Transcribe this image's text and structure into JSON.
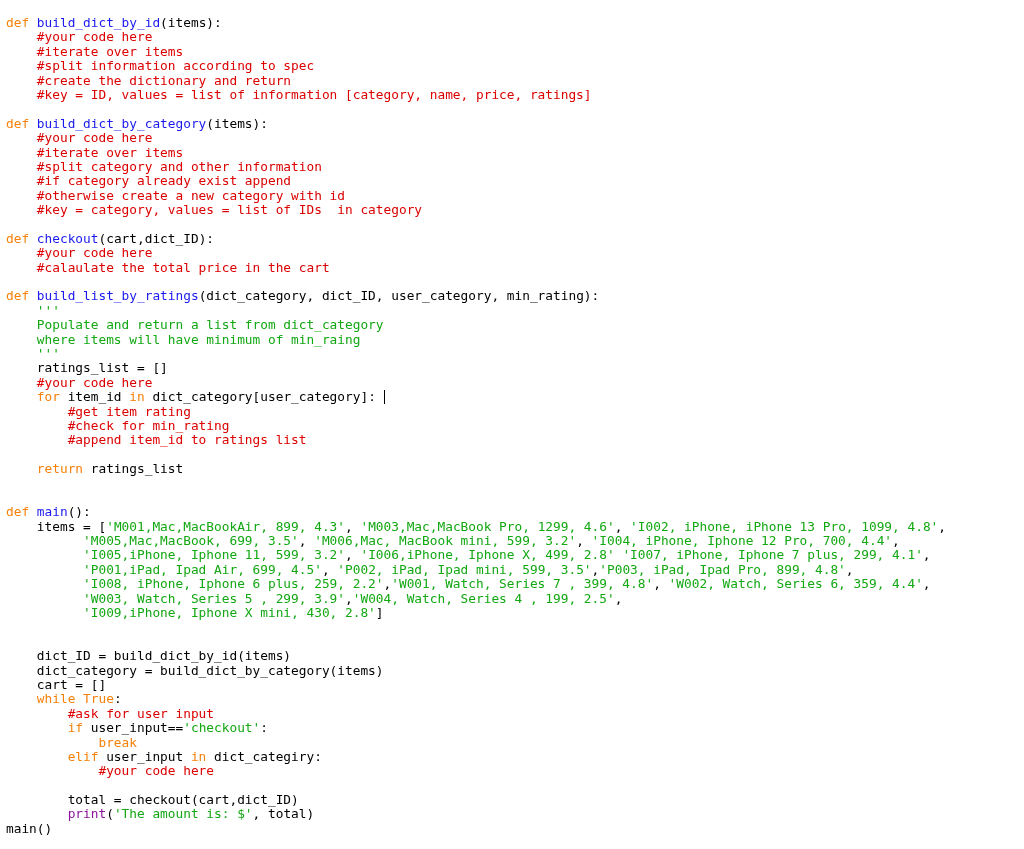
{
  "editor": {
    "lines": [
      {
        "kind": "code",
        "tokens": [
          {
            "kind": "keyword",
            "text": "def "
          },
          {
            "kind": "function",
            "text": "build_dict_by_id"
          },
          {
            "kind": "plain",
            "text": "(items):"
          }
        ]
      },
      {
        "kind": "code",
        "tokens": [
          {
            "kind": "comment",
            "text": "    #your code here"
          }
        ]
      },
      {
        "kind": "code",
        "tokens": [
          {
            "kind": "comment",
            "text": "    #iterate over items"
          }
        ]
      },
      {
        "kind": "code",
        "tokens": [
          {
            "kind": "comment",
            "text": "    #split information according to spec"
          }
        ]
      },
      {
        "kind": "code",
        "tokens": [
          {
            "kind": "comment",
            "text": "    #create the dictionary and return"
          }
        ]
      },
      {
        "kind": "code",
        "tokens": [
          {
            "kind": "comment",
            "text": "    #key = ID, values = list of information [category, name, price, ratings]"
          }
        ]
      },
      {
        "kind": "blank"
      },
      {
        "kind": "code",
        "tokens": [
          {
            "kind": "keyword",
            "text": "def "
          },
          {
            "kind": "function",
            "text": "build_dict_by_category"
          },
          {
            "kind": "plain",
            "text": "(items):"
          }
        ]
      },
      {
        "kind": "code",
        "tokens": [
          {
            "kind": "comment",
            "text": "    #your code here"
          }
        ]
      },
      {
        "kind": "code",
        "tokens": [
          {
            "kind": "comment",
            "text": "    #iterate over items"
          }
        ]
      },
      {
        "kind": "code",
        "tokens": [
          {
            "kind": "comment",
            "text": "    #split category and other information"
          }
        ]
      },
      {
        "kind": "code",
        "tokens": [
          {
            "kind": "comment",
            "text": "    #if category already exist append"
          }
        ]
      },
      {
        "kind": "code",
        "tokens": [
          {
            "kind": "comment",
            "text": "    #otherwise create a new category with id"
          }
        ]
      },
      {
        "kind": "code",
        "tokens": [
          {
            "kind": "comment",
            "text": "    #key = category, values = list of IDs  in category"
          }
        ]
      },
      {
        "kind": "blank"
      },
      {
        "kind": "code",
        "tokens": [
          {
            "kind": "keyword",
            "text": "def "
          },
          {
            "kind": "function",
            "text": "checkout"
          },
          {
            "kind": "plain",
            "text": "(cart,dict_ID):"
          }
        ]
      },
      {
        "kind": "code",
        "tokens": [
          {
            "kind": "comment",
            "text": "    #your code here"
          }
        ]
      },
      {
        "kind": "code",
        "tokens": [
          {
            "kind": "comment",
            "text": "    #calaulate the total price in the cart"
          }
        ]
      },
      {
        "kind": "blank"
      },
      {
        "kind": "code",
        "tokens": [
          {
            "kind": "keyword",
            "text": "def "
          },
          {
            "kind": "function",
            "text": "build_list_by_ratings"
          },
          {
            "kind": "plain",
            "text": "(dict_category, dict_ID, user_category, min_rating):"
          }
        ]
      },
      {
        "kind": "code",
        "tokens": [
          {
            "kind": "string",
            "text": "    '''"
          }
        ]
      },
      {
        "kind": "code",
        "tokens": [
          {
            "kind": "string",
            "text": "    Populate and return a list from dict_category"
          }
        ]
      },
      {
        "kind": "code",
        "tokens": [
          {
            "kind": "string",
            "text": "    where items will have minimum of min_raing"
          }
        ]
      },
      {
        "kind": "code",
        "tokens": [
          {
            "kind": "string",
            "text": "    '''"
          }
        ]
      },
      {
        "kind": "code",
        "tokens": [
          {
            "kind": "plain",
            "text": "    ratings_list = []"
          }
        ]
      },
      {
        "kind": "code",
        "tokens": [
          {
            "kind": "comment",
            "text": "    #your code here"
          }
        ]
      },
      {
        "kind": "code",
        "tokens": [
          {
            "kind": "keyword",
            "text": "    for"
          },
          {
            "kind": "plain",
            "text": " item_id "
          },
          {
            "kind": "keyword",
            "text": "in"
          },
          {
            "kind": "plain",
            "text": " dict_category[user_category]: "
          },
          {
            "kind": "cursor"
          }
        ]
      },
      {
        "kind": "code",
        "tokens": [
          {
            "kind": "comment",
            "text": "        #get item rating"
          }
        ]
      },
      {
        "kind": "code",
        "tokens": [
          {
            "kind": "comment",
            "text": "        #check for min_rating"
          }
        ]
      },
      {
        "kind": "code",
        "tokens": [
          {
            "kind": "comment",
            "text": "        #append item_id to ratings list"
          }
        ]
      },
      {
        "kind": "blank"
      },
      {
        "kind": "code",
        "tokens": [
          {
            "kind": "keyword",
            "text": "    return"
          },
          {
            "kind": "plain",
            "text": " ratings_list"
          }
        ]
      },
      {
        "kind": "blank"
      },
      {
        "kind": "blank"
      },
      {
        "kind": "code",
        "tokens": [
          {
            "kind": "keyword",
            "text": "def "
          },
          {
            "kind": "function",
            "text": "main"
          },
          {
            "kind": "plain",
            "text": "():"
          }
        ]
      },
      {
        "kind": "code",
        "tokens": [
          {
            "kind": "plain",
            "text": "    items = ["
          },
          {
            "kind": "string",
            "text": "'M001,Mac,MacBookAir, 899, 4.3'"
          },
          {
            "kind": "plain",
            "text": ", "
          },
          {
            "kind": "string",
            "text": "'M003,Mac,MacBook Pro, 1299, 4.6'"
          },
          {
            "kind": "plain",
            "text": ", "
          },
          {
            "kind": "string",
            "text": "'I002, iPhone, iPhone 13 Pro, 1099, 4.8'"
          },
          {
            "kind": "plain",
            "text": ","
          }
        ]
      },
      {
        "kind": "code",
        "tokens": [
          {
            "kind": "string",
            "text": "          'M005,Mac,MacBook, 699, 3.5'"
          },
          {
            "kind": "plain",
            "text": ", "
          },
          {
            "kind": "string",
            "text": "'M006,Mac, MacBook mini, 599, 3.2'"
          },
          {
            "kind": "plain",
            "text": ", "
          },
          {
            "kind": "string",
            "text": "'I004, iPhone, Iphone 12 Pro, 700, 4.4'"
          },
          {
            "kind": "plain",
            "text": ","
          }
        ]
      },
      {
        "kind": "code",
        "tokens": [
          {
            "kind": "string",
            "text": "          'I005,iPhone, Iphone 11, 599, 3.2'"
          },
          {
            "kind": "plain",
            "text": ", "
          },
          {
            "kind": "string",
            "text": "'I006,iPhone, Iphone X, 499, 2.8'"
          },
          {
            "kind": "string",
            "text": " 'I007, iPhone, Iphone 7 plus, 299, 4.1'"
          },
          {
            "kind": "plain",
            "text": ","
          }
        ]
      },
      {
        "kind": "code",
        "tokens": [
          {
            "kind": "string",
            "text": "          'P001,iPad, Ipad Air, 699, 4.5'"
          },
          {
            "kind": "plain",
            "text": ", "
          },
          {
            "kind": "string",
            "text": "'P002, iPad, Ipad mini, 599, 3.5'"
          },
          {
            "kind": "plain",
            "text": ","
          },
          {
            "kind": "string",
            "text": "'P003, iPad, Ipad Pro, 899, 4.8'"
          },
          {
            "kind": "plain",
            "text": ","
          }
        ]
      },
      {
        "kind": "code",
        "tokens": [
          {
            "kind": "string",
            "text": "          'I008, iPhone, Iphone 6 plus, 259, 2.2'"
          },
          {
            "kind": "plain",
            "text": ","
          },
          {
            "kind": "string",
            "text": "'W001, Watch, Series 7 , 399, 4.8'"
          },
          {
            "kind": "plain",
            "text": ", "
          },
          {
            "kind": "string",
            "text": "'W002, Watch, Series 6, 359, 4.4'"
          },
          {
            "kind": "plain",
            "text": ","
          }
        ]
      },
      {
        "kind": "code",
        "tokens": [
          {
            "kind": "string",
            "text": "          'W003, Watch, Series 5 , 299, 3.9'"
          },
          {
            "kind": "plain",
            "text": ","
          },
          {
            "kind": "string",
            "text": "'W004, Watch, Series 4 , 199, 2.5'"
          },
          {
            "kind": "plain",
            "text": ","
          }
        ]
      },
      {
        "kind": "code",
        "tokens": [
          {
            "kind": "string",
            "text": "          'I009,iPhone, Iphone X mini, 430, 2.8'"
          },
          {
            "kind": "plain",
            "text": "]"
          }
        ]
      },
      {
        "kind": "blank"
      },
      {
        "kind": "blank"
      },
      {
        "kind": "code",
        "tokens": [
          {
            "kind": "plain",
            "text": "    dict_ID = build_dict_by_id(items)"
          }
        ]
      },
      {
        "kind": "code",
        "tokens": [
          {
            "kind": "plain",
            "text": "    dict_category = build_dict_by_category(items)"
          }
        ]
      },
      {
        "kind": "code",
        "tokens": [
          {
            "kind": "plain",
            "text": "    cart = []"
          }
        ]
      },
      {
        "kind": "code",
        "tokens": [
          {
            "kind": "keyword",
            "text": "    while True"
          },
          {
            "kind": "plain",
            "text": ":"
          }
        ]
      },
      {
        "kind": "code",
        "tokens": [
          {
            "kind": "comment",
            "text": "        #ask for user input"
          }
        ]
      },
      {
        "kind": "code",
        "tokens": [
          {
            "kind": "keyword",
            "text": "        if"
          },
          {
            "kind": "plain",
            "text": " user_input=="
          },
          {
            "kind": "string",
            "text": "'checkout'"
          },
          {
            "kind": "plain",
            "text": ":"
          }
        ]
      },
      {
        "kind": "code",
        "tokens": [
          {
            "kind": "keyword",
            "text": "            break"
          }
        ]
      },
      {
        "kind": "code",
        "tokens": [
          {
            "kind": "keyword",
            "text": "        elif"
          },
          {
            "kind": "plain",
            "text": " user_input "
          },
          {
            "kind": "keyword",
            "text": "in"
          },
          {
            "kind": "plain",
            "text": " dict_categiry:"
          }
        ]
      },
      {
        "kind": "code",
        "tokens": [
          {
            "kind": "comment",
            "text": "            #your code here"
          }
        ]
      },
      {
        "kind": "blank"
      },
      {
        "kind": "code",
        "tokens": [
          {
            "kind": "plain",
            "text": "        total = checkout(cart,dict_ID)"
          }
        ]
      },
      {
        "kind": "code",
        "tokens": [
          {
            "kind": "builtin",
            "text": "        print"
          },
          {
            "kind": "plain",
            "text": "("
          },
          {
            "kind": "string",
            "text": "'The amount is: $'"
          },
          {
            "kind": "plain",
            "text": ", total)"
          }
        ]
      },
      {
        "kind": "code",
        "tokens": [
          {
            "kind": "plain",
            "text": "main()"
          }
        ]
      }
    ]
  }
}
